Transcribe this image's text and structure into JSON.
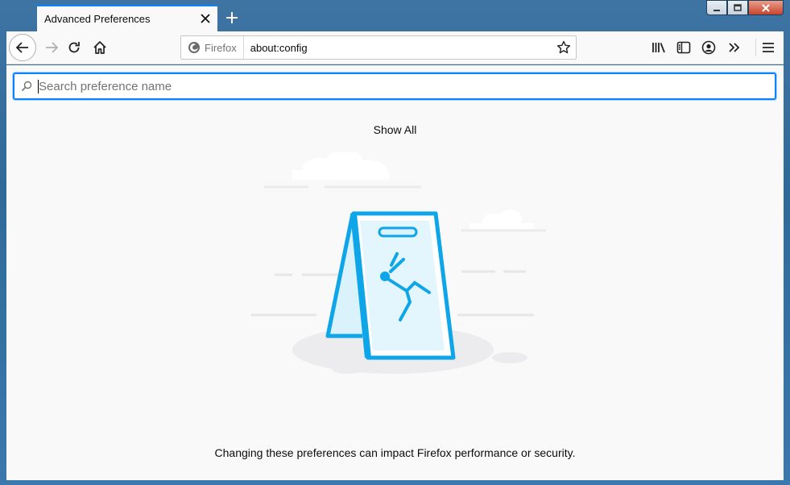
{
  "window": {
    "controls": {
      "minimize": "—",
      "maximize": "□",
      "close": "✕"
    }
  },
  "tabs": [
    {
      "title": "Advanced Preferences",
      "active": true
    }
  ],
  "new_tab_label": "+",
  "toolbar": {
    "identity_label": "Firefox",
    "url": "about:config",
    "icons": [
      "back-icon",
      "forward-icon",
      "reload-icon",
      "home-icon",
      "bookmark-star-icon",
      "library-icon",
      "sidebar-icon",
      "account-icon",
      "overflow-icon",
      "menu-icon"
    ]
  },
  "search": {
    "placeholder": "Search preference name",
    "value": ""
  },
  "show_all_label": "Show All",
  "warning_text": "Changing these preferences can impact Firefox performance or security.",
  "colors": {
    "accent": "#0a84ff",
    "illustration_blue": "#0ea5e9",
    "illustration_light": "#d9f2fc",
    "background": "#f9f9fa"
  }
}
